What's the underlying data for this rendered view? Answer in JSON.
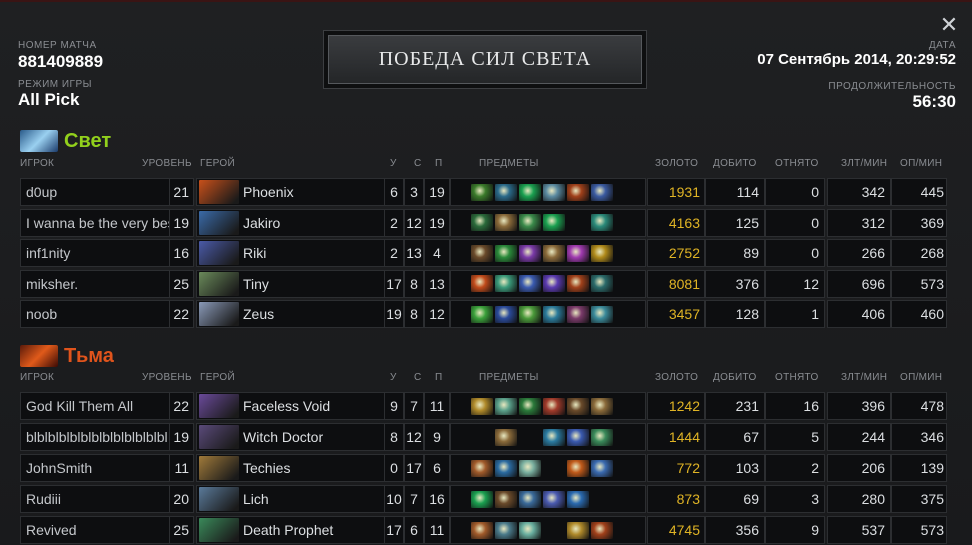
{
  "match": {
    "id_label": "НОМЕР МАТЧА",
    "id": "881409889",
    "mode_label": "РЕЖИМ ИГРЫ",
    "mode": "All Pick",
    "date_label": "ДАТА",
    "date": "07 Сентябрь 2014, 20:29:52",
    "duration_label": "ПРОДОЛЖИТЕЛЬНОСТЬ",
    "duration": "56:30",
    "result": "ПОБЕДА СИЛ СВЕТА"
  },
  "close_icon": "close-icon",
  "columns": {
    "player": "ИГРОК",
    "level": "УРОВЕНЬ",
    "hero": "ГЕРОЙ",
    "kills": "У",
    "deaths": "С",
    "assists": "П",
    "items": "ПРЕДМЕТЫ",
    "gold": "ЗОЛОТО",
    "last_hits": "ДОБИТО",
    "denies": "ОТНЯТО",
    "gpm": "ЗЛТ/МИН",
    "xpm": "ОП/МИН"
  },
  "colors": {
    "radiant": "#92d01c",
    "dire": "#e0541c",
    "gold": "#e0b425"
  },
  "radiant": {
    "name": "Свет",
    "players": [
      {
        "name": "d0up",
        "level": "21",
        "hero": "Phoenix",
        "kills": "6",
        "deaths": "3",
        "assists": "19",
        "gold": "1931",
        "last_hits": "114",
        "denies": "0",
        "gpm": "342",
        "xpm": "445",
        "hero_color": "#c8501a",
        "items": [
          "#3a7a2a",
          "#2a6a8a",
          "#1aa050",
          "#5a8aa0",
          "#a0401a",
          "#3a5aa0"
        ]
      },
      {
        "name": "I wanna be the very best",
        "level": "19",
        "hero": "Jakiro",
        "kills": "2",
        "deaths": "12",
        "assists": "19",
        "gold": "4163",
        "last_hits": "125",
        "denies": "0",
        "gpm": "312",
        "xpm": "369",
        "hero_color": "#3a6aa8",
        "items": [
          "#2a6a3a",
          "#8a6a3a",
          "#3a8a4a",
          "#1aa050",
          "",
          "#2a8a7a"
        ]
      },
      {
        "name": "inf1nity",
        "level": "16",
        "hero": "Riki",
        "kills": "2",
        "deaths": "13",
        "assists": "4",
        "gold": "2752",
        "last_hits": "89",
        "denies": "0",
        "gpm": "266",
        "xpm": "268",
        "hero_color": "#4a5aa8",
        "items": [
          "#6a4a2a",
          "#2a8a3a",
          "#7a3aa8",
          "#8a6a3a",
          "#a03ab0",
          "#b08a1a"
        ]
      },
      {
        "name": "miksher.",
        "level": "25",
        "hero": "Tiny",
        "kills": "17",
        "deaths": "8",
        "assists": "13",
        "gold": "8081",
        "last_hits": "376",
        "denies": "12",
        "gpm": "696",
        "xpm": "573",
        "hero_color": "#6a8a5a",
        "items": [
          "#c04a1a",
          "#3a9a7a",
          "#3a5ab0",
          "#5a3ab0",
          "#a0401a",
          "#2a6a6a"
        ]
      },
      {
        "name": "noob",
        "level": "22",
        "hero": "Zeus",
        "kills": "19",
        "deaths": "8",
        "assists": "12",
        "gold": "3457",
        "last_hits": "128",
        "denies": "1",
        "gpm": "406",
        "xpm": "460",
        "hero_color": "#8a9ab8",
        "items": [
          "#3aa03a",
          "#2a4a9a",
          "#4a9a3a",
          "#2a7a9a",
          "#7a3a6a",
          "#3a8a9a"
        ]
      }
    ]
  },
  "dire": {
    "name": "Тьма",
    "players": [
      {
        "name": "God Kill Them All",
        "level": "22",
        "hero": "Faceless Void",
        "kills": "9",
        "deaths": "7",
        "assists": "11",
        "gold": "1242",
        "last_hits": "231",
        "denies": "16",
        "gpm": "396",
        "xpm": "478",
        "hero_color": "#6a4a9a",
        "items": [
          "#b08a2a",
          "#5aa08a",
          "#2a7a3a",
          "#a03a2a",
          "#6a4a2a",
          "#8a6a3a"
        ]
      },
      {
        "name": "blblblblblblblblblblblblbl",
        "level": "19",
        "hero": "Witch Doctor",
        "kills": "8",
        "deaths": "12",
        "assists": "9",
        "gold": "1444",
        "last_hits": "67",
        "denies": "5",
        "gpm": "244",
        "xpm": "346",
        "hero_color": "#5a4a7a",
        "items": [
          "",
          "#8a6a3a",
          "",
          "#2a7aa0",
          "#3a5ab0",
          "#3a8a5a"
        ]
      },
      {
        "name": "JohnSmith",
        "level": "11",
        "hero": "Techies",
        "kills": "0",
        "deaths": "17",
        "assists": "6",
        "gold": "772",
        "last_hits": "103",
        "denies": "2",
        "gpm": "206",
        "xpm": "139",
        "hero_color": "#a07a3a",
        "items": [
          "#a05a2a",
          "#2a6aa0",
          "#7ab0a0",
          "",
          "#c05a1a",
          "#3a6ab0"
        ]
      },
      {
        "name": "Rudiii",
        "level": "20",
        "hero": "Lich",
        "kills": "10",
        "deaths": "7",
        "assists": "16",
        "gold": "873",
        "last_hits": "69",
        "denies": "3",
        "gpm": "280",
        "xpm": "375",
        "hero_color": "#5a7a9a",
        "items": [
          "#1aa050",
          "#6a4a2a",
          "#3a6a9a",
          "#4a5ab0",
          "#2a6ab0",
          ""
        ]
      },
      {
        "name": "Revived",
        "level": "25",
        "hero": "Death Prophet",
        "kills": "17",
        "deaths": "6",
        "assists": "11",
        "gold": "4745",
        "last_hits": "356",
        "denies": "9",
        "gpm": "537",
        "xpm": "573",
        "hero_color": "#3a8a5a",
        "items": [
          "#a05a2a",
          "#4a7a8a",
          "#6ab0a0",
          "",
          "#b08a2a",
          "#a0401a"
        ]
      }
    ]
  }
}
